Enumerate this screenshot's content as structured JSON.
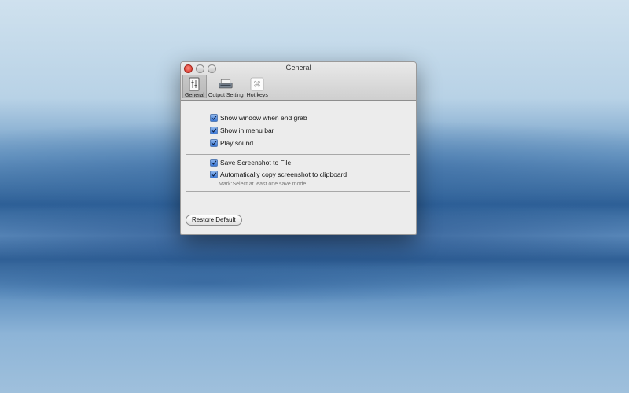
{
  "window": {
    "title": "General"
  },
  "toolbar": {
    "items": [
      {
        "label": "General",
        "selected": true,
        "icon": "general-icon"
      },
      {
        "label": "Output Setting",
        "selected": false,
        "icon": "output-setting-icon"
      },
      {
        "label": "Hot keys",
        "selected": false,
        "icon": "command-key-icon"
      }
    ]
  },
  "options": {
    "show_window": {
      "label": "Show window when end grab",
      "checked": true
    },
    "show_menu_bar": {
      "label": "Show in menu bar",
      "checked": true
    },
    "play_sound": {
      "label": "Play sound",
      "checked": true
    },
    "save_to_file": {
      "label": "Save Screenshot to File",
      "checked": true
    },
    "copy_clipboard": {
      "label": "Automatically copy screenshot to clipboard",
      "checked": true
    },
    "note": "Mark:Select at least one save mode"
  },
  "restore_default": "Restore Default",
  "colors": {
    "checkbox_accent": "#3b78d6",
    "close_button": "#d0261b"
  }
}
